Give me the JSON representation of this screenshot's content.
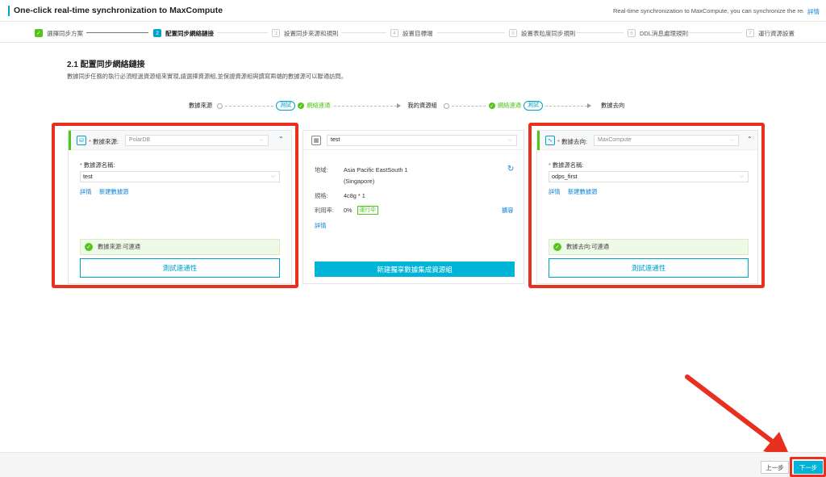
{
  "header": {
    "title": "One-click real-time synchronization to MaxCompute",
    "description": "Real-time synchronization to MaxCompute, you can synchronize the real-ti...",
    "details_link": "詳情"
  },
  "steps": [
    {
      "num": "✓",
      "label": "選擇同步方案",
      "state": "done"
    },
    {
      "num": "2",
      "label": "配置同步網絡鏈接",
      "state": "active"
    },
    {
      "num": "3",
      "label": "設置同步來源和規則",
      "state": "pending"
    },
    {
      "num": "4",
      "label": "設置目標端",
      "state": "pending"
    },
    {
      "num": "5",
      "label": "設置表粒度同步規則",
      "state": "pending"
    },
    {
      "num": "6",
      "label": "DDL消息處理規則",
      "state": "pending"
    },
    {
      "num": "7",
      "label": "運行資源設置",
      "state": "pending"
    }
  ],
  "section": {
    "title": "2.1 配置同步網絡鏈接",
    "subtitle": "數據同步任務的執行必須經過資源組來實現,請選擇資源組,並保證資源組與讀寫兩端的數據源可以聯通訪問。"
  },
  "flow": {
    "source": "數據來源",
    "test1": "測試",
    "net1": "網絡連通",
    "resource_group": "我的資源組",
    "net2": "網絡連通",
    "test2": "測試",
    "target": "數據去向"
  },
  "source_panel": {
    "label_req": "*",
    "label": "數據來源:",
    "type_value": "PolarDB",
    "ds_label_req": "*",
    "ds_label": "數據源名稱:",
    "ds_value": "test",
    "details": "詳情",
    "new_ds": "新建數據源",
    "status": "數據來源:可連通",
    "test_button": "測試連通性"
  },
  "resource_panel": {
    "select_value": "test",
    "region_label": "地域:",
    "region_value": "Asia Pacific EastSouth 1",
    "region_value2": "(Singapore)",
    "spec_label": "規格:",
    "spec_value": "4c8g * 1",
    "usage_label": "利用率:",
    "usage_value": "0%",
    "status_badge": "運行中",
    "expand": "擴容",
    "details": "詳情",
    "create_button": "新建獨享數據集成資源組"
  },
  "target_panel": {
    "label_req": "*",
    "label": "數據去向:",
    "type_value": "MaxCompute",
    "ds_label_req": "*",
    "ds_label": "數據源名稱:",
    "ds_value": "odps_first",
    "details": "詳情",
    "new_ds": "新建數據源",
    "status": "數據去向:可連通",
    "test_button": "測試連通性"
  },
  "footer": {
    "prev": "上一步",
    "next": "下一步"
  },
  "colors": {
    "accent": "#00a2c9",
    "success": "#52c41a",
    "highlight": "#e8301f"
  }
}
